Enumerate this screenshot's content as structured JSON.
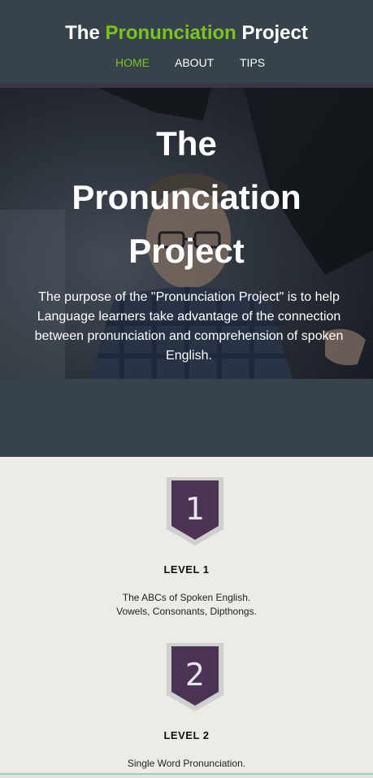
{
  "header": {
    "title_prefix": "The ",
    "title_accent": "Pronunciation",
    "title_suffix": " Project",
    "nav": [
      {
        "label": "HOME",
        "active": true
      },
      {
        "label": "ABOUT",
        "active": false
      },
      {
        "label": "TIPS",
        "active": false
      }
    ],
    "colors": {
      "background": "#36434b",
      "accent": "#7dc221",
      "border": "#3d3447"
    }
  },
  "hero": {
    "title_line1": "The",
    "title_line2": "Pronunciation",
    "title_line3": "Project",
    "text": "The purpose of the \"Pronunciation Project\" is to help Language learners take advantage of the connection between pronunciation and comprehension of spoken English."
  },
  "levels": [
    {
      "number": "1",
      "title": "LEVEL 1",
      "desc_line1": "The ABCs of Spoken English.",
      "desc_line2": "Vowels, Consonants, Dipthongs."
    },
    {
      "number": "2",
      "title": "LEVEL 2",
      "desc_line1": "Single Word Pronunciation."
    }
  ],
  "icons": {
    "level_badge": "shield-badge-icon"
  },
  "colors": {
    "badge_fill": "#4b3355",
    "badge_border": "#c9c9c9",
    "page_background": "#edebe7"
  }
}
